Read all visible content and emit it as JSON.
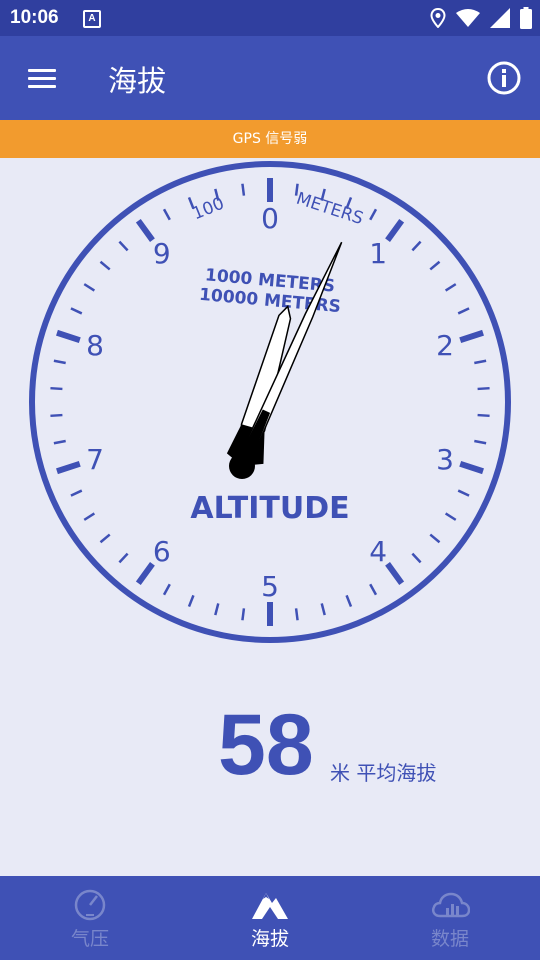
{
  "status_bar": {
    "time": "10:06",
    "notification_letter": "A",
    "icons": [
      "location-icon",
      "wifi-icon",
      "signal-icon",
      "battery-icon"
    ]
  },
  "app_bar": {
    "title": "海拔",
    "menu_icon": "hamburger-menu-icon",
    "info_icon": "info-icon"
  },
  "banner": {
    "text": "GPS 信号弱",
    "color": "#f29b2e"
  },
  "gauge": {
    "dial_numbers": [
      "0",
      "1",
      "2",
      "3",
      "4",
      "5",
      "6",
      "7",
      "8",
      "9"
    ],
    "label_100": "100",
    "label_meters_top": "METERS",
    "label_1000": "1000 METERS",
    "label_10000": "10000 METERS",
    "label_altitude": "ALTITUDE",
    "long_hand_value": 0.58,
    "short_hand_value": 0.06,
    "color": "#3f51b5"
  },
  "reading": {
    "value": "58",
    "unit": "米 平均海拔"
  },
  "bottom_nav": {
    "items": [
      {
        "label": "气压",
        "icon": "barometer-icon",
        "active": false
      },
      {
        "label": "海拔",
        "icon": "mountain-icon",
        "active": true
      },
      {
        "label": "数据",
        "icon": "cloud-chart-icon",
        "active": false
      }
    ]
  },
  "colors": {
    "primary": "#3f51b5",
    "primary_dark": "#303f9f",
    "background": "#e8eaf6",
    "inactive_nav": "#7986cb"
  }
}
